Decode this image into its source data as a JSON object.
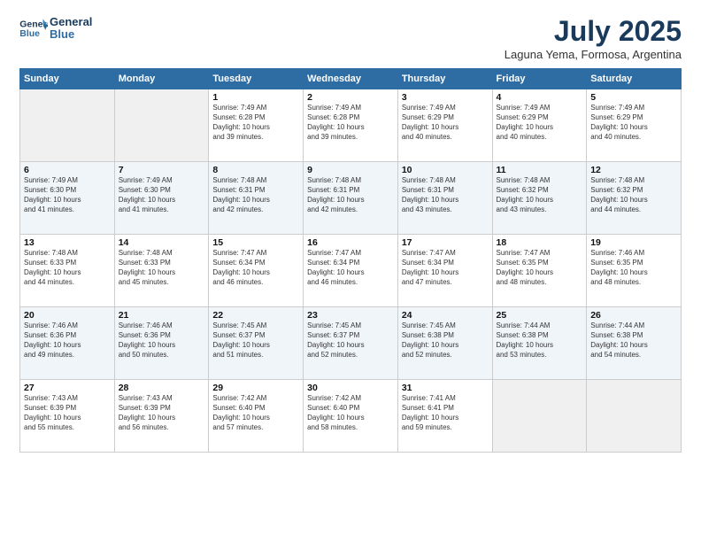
{
  "header": {
    "logo_line1": "General",
    "logo_line2": "Blue",
    "title": "July 2025",
    "location": "Laguna Yema, Formosa, Argentina"
  },
  "weekdays": [
    "Sunday",
    "Monday",
    "Tuesday",
    "Wednesday",
    "Thursday",
    "Friday",
    "Saturday"
  ],
  "weeks": [
    [
      {
        "day": "",
        "info": ""
      },
      {
        "day": "",
        "info": ""
      },
      {
        "day": "1",
        "info": "Sunrise: 7:49 AM\nSunset: 6:28 PM\nDaylight: 10 hours\nand 39 minutes."
      },
      {
        "day": "2",
        "info": "Sunrise: 7:49 AM\nSunset: 6:28 PM\nDaylight: 10 hours\nand 39 minutes."
      },
      {
        "day": "3",
        "info": "Sunrise: 7:49 AM\nSunset: 6:29 PM\nDaylight: 10 hours\nand 40 minutes."
      },
      {
        "day": "4",
        "info": "Sunrise: 7:49 AM\nSunset: 6:29 PM\nDaylight: 10 hours\nand 40 minutes."
      },
      {
        "day": "5",
        "info": "Sunrise: 7:49 AM\nSunset: 6:29 PM\nDaylight: 10 hours\nand 40 minutes."
      }
    ],
    [
      {
        "day": "6",
        "info": "Sunrise: 7:49 AM\nSunset: 6:30 PM\nDaylight: 10 hours\nand 41 minutes."
      },
      {
        "day": "7",
        "info": "Sunrise: 7:49 AM\nSunset: 6:30 PM\nDaylight: 10 hours\nand 41 minutes."
      },
      {
        "day": "8",
        "info": "Sunrise: 7:48 AM\nSunset: 6:31 PM\nDaylight: 10 hours\nand 42 minutes."
      },
      {
        "day": "9",
        "info": "Sunrise: 7:48 AM\nSunset: 6:31 PM\nDaylight: 10 hours\nand 42 minutes."
      },
      {
        "day": "10",
        "info": "Sunrise: 7:48 AM\nSunset: 6:31 PM\nDaylight: 10 hours\nand 43 minutes."
      },
      {
        "day": "11",
        "info": "Sunrise: 7:48 AM\nSunset: 6:32 PM\nDaylight: 10 hours\nand 43 minutes."
      },
      {
        "day": "12",
        "info": "Sunrise: 7:48 AM\nSunset: 6:32 PM\nDaylight: 10 hours\nand 44 minutes."
      }
    ],
    [
      {
        "day": "13",
        "info": "Sunrise: 7:48 AM\nSunset: 6:33 PM\nDaylight: 10 hours\nand 44 minutes."
      },
      {
        "day": "14",
        "info": "Sunrise: 7:48 AM\nSunset: 6:33 PM\nDaylight: 10 hours\nand 45 minutes."
      },
      {
        "day": "15",
        "info": "Sunrise: 7:47 AM\nSunset: 6:34 PM\nDaylight: 10 hours\nand 46 minutes."
      },
      {
        "day": "16",
        "info": "Sunrise: 7:47 AM\nSunset: 6:34 PM\nDaylight: 10 hours\nand 46 minutes."
      },
      {
        "day": "17",
        "info": "Sunrise: 7:47 AM\nSunset: 6:34 PM\nDaylight: 10 hours\nand 47 minutes."
      },
      {
        "day": "18",
        "info": "Sunrise: 7:47 AM\nSunset: 6:35 PM\nDaylight: 10 hours\nand 48 minutes."
      },
      {
        "day": "19",
        "info": "Sunrise: 7:46 AM\nSunset: 6:35 PM\nDaylight: 10 hours\nand 48 minutes."
      }
    ],
    [
      {
        "day": "20",
        "info": "Sunrise: 7:46 AM\nSunset: 6:36 PM\nDaylight: 10 hours\nand 49 minutes."
      },
      {
        "day": "21",
        "info": "Sunrise: 7:46 AM\nSunset: 6:36 PM\nDaylight: 10 hours\nand 50 minutes."
      },
      {
        "day": "22",
        "info": "Sunrise: 7:45 AM\nSunset: 6:37 PM\nDaylight: 10 hours\nand 51 minutes."
      },
      {
        "day": "23",
        "info": "Sunrise: 7:45 AM\nSunset: 6:37 PM\nDaylight: 10 hours\nand 52 minutes."
      },
      {
        "day": "24",
        "info": "Sunrise: 7:45 AM\nSunset: 6:38 PM\nDaylight: 10 hours\nand 52 minutes."
      },
      {
        "day": "25",
        "info": "Sunrise: 7:44 AM\nSunset: 6:38 PM\nDaylight: 10 hours\nand 53 minutes."
      },
      {
        "day": "26",
        "info": "Sunrise: 7:44 AM\nSunset: 6:38 PM\nDaylight: 10 hours\nand 54 minutes."
      }
    ],
    [
      {
        "day": "27",
        "info": "Sunrise: 7:43 AM\nSunset: 6:39 PM\nDaylight: 10 hours\nand 55 minutes."
      },
      {
        "day": "28",
        "info": "Sunrise: 7:43 AM\nSunset: 6:39 PM\nDaylight: 10 hours\nand 56 minutes."
      },
      {
        "day": "29",
        "info": "Sunrise: 7:42 AM\nSunset: 6:40 PM\nDaylight: 10 hours\nand 57 minutes."
      },
      {
        "day": "30",
        "info": "Sunrise: 7:42 AM\nSunset: 6:40 PM\nDaylight: 10 hours\nand 58 minutes."
      },
      {
        "day": "31",
        "info": "Sunrise: 7:41 AM\nSunset: 6:41 PM\nDaylight: 10 hours\nand 59 minutes."
      },
      {
        "day": "",
        "info": ""
      },
      {
        "day": "",
        "info": ""
      }
    ]
  ]
}
